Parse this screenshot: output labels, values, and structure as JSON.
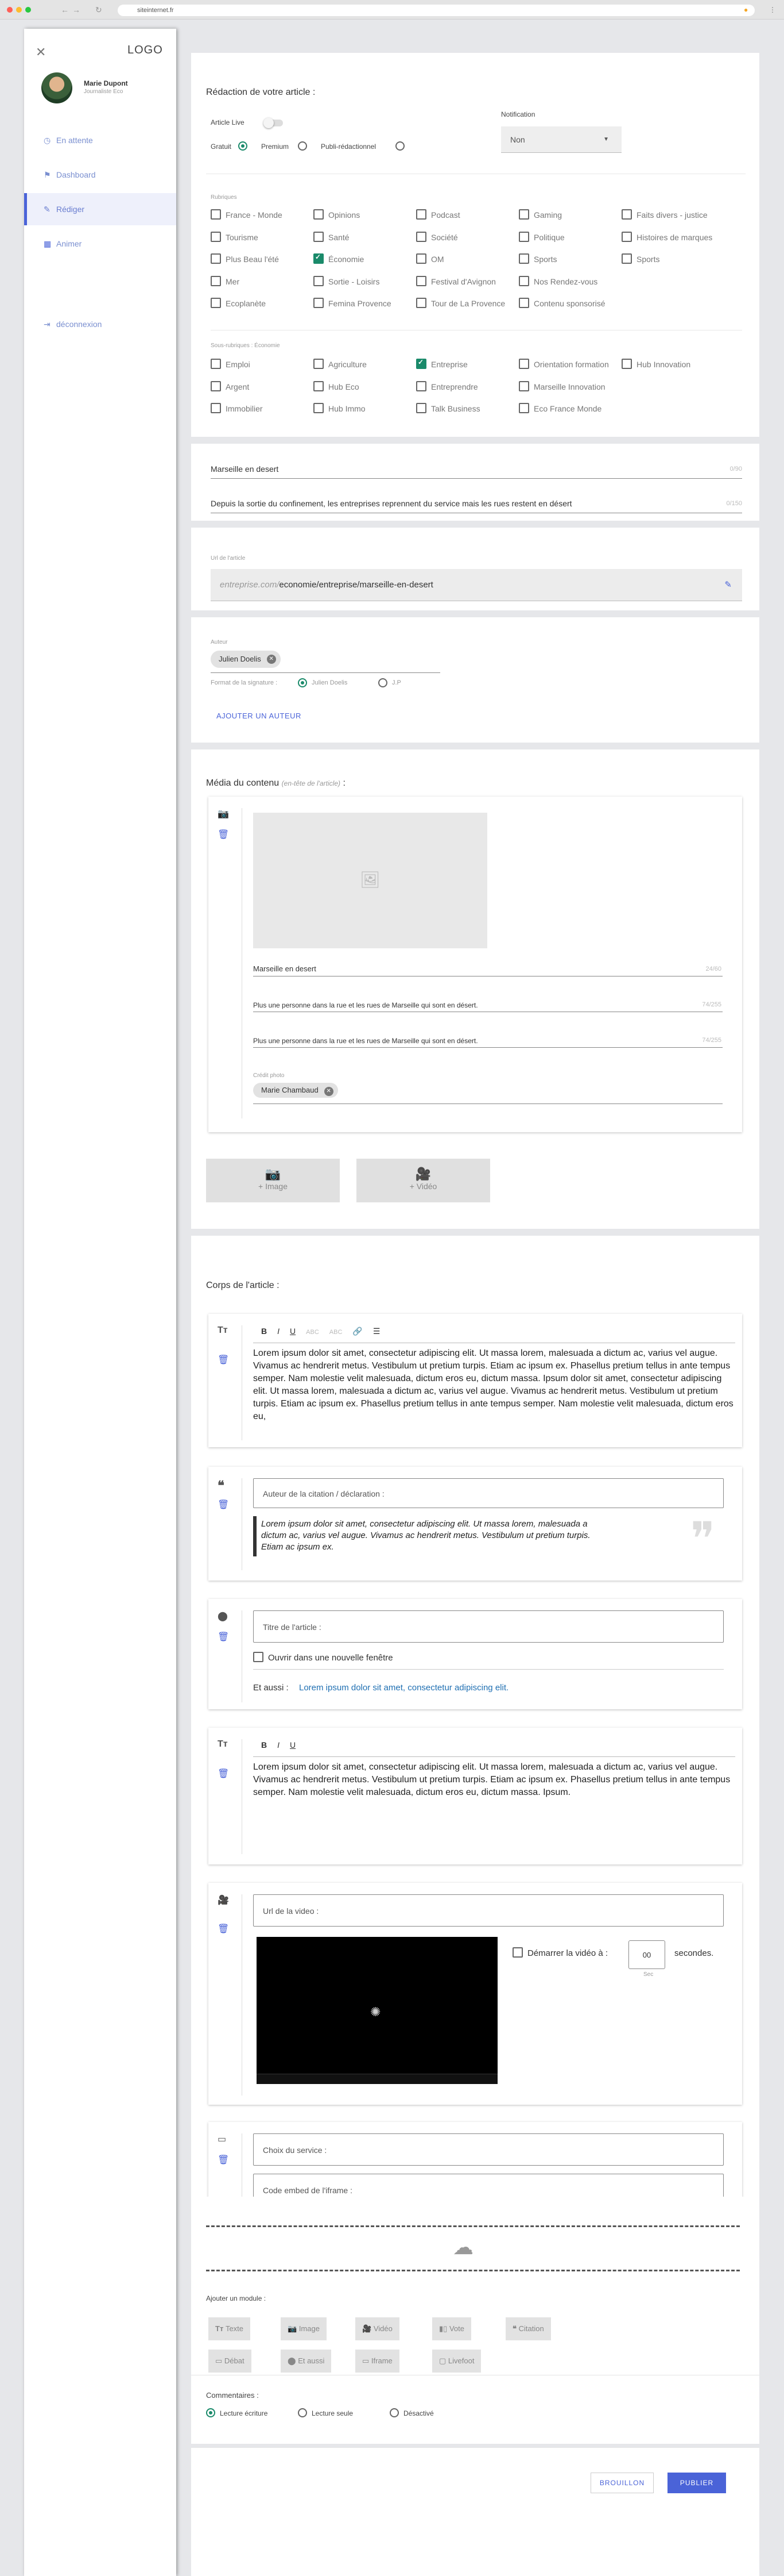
{
  "browser": {
    "url": "siteinternet.fr"
  },
  "sidebar": {
    "logo": "LOGO",
    "user_name": "Marie Dupont",
    "user_role": "Journaliste Eco",
    "items": [
      {
        "label": "En attente",
        "icon": "clock-icon",
        "glyph": "◷"
      },
      {
        "label": "Dashboard",
        "icon": "flag-icon",
        "glyph": "⚑"
      },
      {
        "label": "Rédiger",
        "icon": "pen-icon",
        "glyph": "✎"
      },
      {
        "label": "Animer",
        "icon": "grid-icon",
        "glyph": "▦"
      },
      {
        "label": "déconnexion",
        "icon": "logout-icon",
        "glyph": "⇥"
      }
    ]
  },
  "redaction": {
    "title": "Rédaction de votre article :",
    "article_live": "Article Live",
    "notification_label": "Notification",
    "notification_value": "Non",
    "types": [
      "Gratuit",
      "Premium",
      "Publi-rédactionnel"
    ]
  },
  "rubriques": {
    "label": "Rubriques",
    "items": [
      "France - Monde",
      "Opinions",
      "Podcast",
      "Gaming",
      "Faits divers - justice",
      "Tourisme",
      "Santé",
      "Société",
      "Politique",
      "Histoires de marques",
      "Plus Beau l'été",
      "Économie",
      "OM",
      "Sports",
      "Sports",
      "Mer",
      "Sortie - Loisirs",
      "Festival d'Avignon",
      "Nos Rendez-vous",
      "",
      "Ecoplanète",
      "Femina Provence",
      "Tour de La Provence",
      "Contenu sponsorisé",
      ""
    ],
    "checked": "Économie"
  },
  "sous_rubriques": {
    "label": "Sous-rubriques : Économie",
    "items": [
      "Emploi",
      "Agriculture",
      "Entreprise",
      "Orientation formation",
      "Hub Innovation",
      "Argent",
      "Hub Eco",
      "Entreprendre",
      "Marseille Innovation",
      "",
      "Immobilier",
      "Hub Immo",
      "Talk Business",
      "Eco France Monde",
      ""
    ],
    "checked": "Entreprise"
  },
  "article": {
    "title": "Marseille en desert",
    "title_count": "0/90",
    "subtitle": "Depuis la sortie du confinement, les entreprises reprennent du service mais les rues restent en désert",
    "subtitle_count": "0/150",
    "url_label": "Url de l'article",
    "url_prefix": "entreprise.com/",
    "url_path": "economie/entreprise/marseille-en-desert"
  },
  "auteur": {
    "label": "Auteur",
    "chip": "Julien Doelis",
    "format_label": "Format de la signature :",
    "formats": [
      "Julien Doelis",
      "J.P"
    ],
    "add_button": "AJOUTER UN AUTEUR"
  },
  "media": {
    "title": "Média du contenu",
    "title_note": "(en-tête de l'article)",
    "colon": ":",
    "caption": "Marseille en desert",
    "caption_count": "24/60",
    "alt1": "Plus une personne dans la rue et les rues de Marseille qui sont en désert.",
    "alt1_count": "74/255",
    "alt2": "Plus une personne dans la rue et les rues de Marseille qui sont en désert.",
    "alt2_count": "74/255",
    "credit_label": "Crédit photo",
    "credit_chip": "Marie Chambaud",
    "add_image": "+ Image",
    "add_video": "+ Vidéo"
  },
  "corps": {
    "title": "Corps de l'article :",
    "toolbar": [
      "B",
      "I",
      "U",
      "ABC",
      "ABC",
      "🔗",
      "☰"
    ],
    "text1": "Lorem ipsum dolor sit amet, consectetur adipiscing elit. Ut massa lorem, malesuada a dictum ac, varius vel augue. Vivamus ac hendrerit metus. Vestibulum ut pretium turpis. Etiam ac ipsum ex. Phasellus pretium tellus in ante tempus semper. Nam molestie velit malesuada, dictum eros eu, dictum massa. Ipsum dolor sit amet, consectetur adipiscing elit. Ut massa lorem, malesuada a dictum ac, varius vel augue. Vivamus ac hendrerit metus. Vestibulum ut pretium turpis. Etiam ac ipsum ex. Phasellus pretium tellus in ante tempus semper. Nam molestie velit malesuada, dictum eros eu,",
    "quote_author": "Auteur de la citation / déclaration :",
    "quote_text": "Lorem ipsum dolor sit amet, consectetur adipiscing elit. Ut massa lorem, malesuada a dictum ac, varius vel augue. Vivamus ac hendrerit metus. Vestibulum ut pretium turpis. Etiam ac ipsum ex.",
    "link_title": "Titre de l'article :",
    "link_newtab": "Ouvrir dans une nouvelle fenêtre",
    "et_aussi": "Et aussi :",
    "et_aussi_link": "Lorem ipsum dolor sit amet, consectetur adipiscing elit.",
    "toolbar2": [
      "B",
      "I",
      "U"
    ],
    "text2": "Lorem ipsum dolor sit amet, consectetur adipiscing elit. Ut massa lorem, malesuada a dictum ac, varius vel augue. Vivamus ac hendrerit metus. Vestibulum ut pretium turpis. Etiam ac ipsum ex. Phasellus pretium tellus in ante tempus semper. Nam molestie velit malesuada, dictum eros eu, dictum massa. Ipsum.",
    "video_url": "Url de la video :",
    "video_start": "Démarrer la vidéo à :",
    "video_seconds_value": "00",
    "video_seconds": "secondes.",
    "video_sec": "Sec",
    "service": "Choix du service :",
    "embed": "Code embed de l'iframe :",
    "add_module": "Ajouter un module :",
    "modules": [
      "Texte",
      "Image",
      "Vidéo",
      "Vote",
      "Citation",
      "Débat",
      "Et aussi",
      "Iframe",
      "Livefoot"
    ]
  },
  "commentaires": {
    "label": "Commentaires :",
    "options": [
      "Lecture écriture",
      "Lecture seule",
      "Désactivé"
    ]
  },
  "footer": {
    "draft": "BROUILLON",
    "publish": "PUBLIER"
  }
}
